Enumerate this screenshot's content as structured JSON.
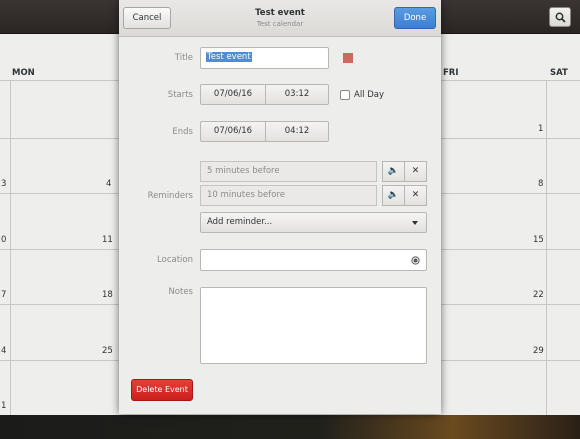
{
  "toolbar": {
    "search_icon": "search-icon"
  },
  "calendar": {
    "days": {
      "mon": "MON",
      "fri": "FRI",
      "sat": "SAT"
    },
    "left_numbers": [
      "3",
      "0",
      "7",
      "4",
      "1"
    ],
    "mon_numbers": [
      "4",
      "11",
      "18",
      "25"
    ],
    "fri_numbers": [
      "1",
      "8",
      "15",
      "22",
      "29"
    ]
  },
  "dialog": {
    "cancel_label": "Cancel",
    "done_label": "Done",
    "title": "Test event",
    "subtitle": "Test calendar",
    "labels": {
      "title": "Title",
      "starts": "Starts",
      "ends": "Ends",
      "reminders": "Reminders",
      "location": "Location",
      "notes": "Notes"
    },
    "title_value": "Test event",
    "starts_date": "07/06/16",
    "starts_time": "03:12",
    "all_day_label": "All Day",
    "ends_date": "07/06/16",
    "ends_time": "04:12",
    "reminders": [
      "5 minutes before",
      "10 minutes before"
    ],
    "add_reminder_label": "Add reminder...",
    "location_value": "",
    "notes_value": "",
    "delete_label": "Delete Event",
    "remove_glyph": "✕",
    "colors": {
      "calendar_color": "#d0695d",
      "accent": "#3c7fd2",
      "destructive": "#cc1f1c"
    }
  }
}
